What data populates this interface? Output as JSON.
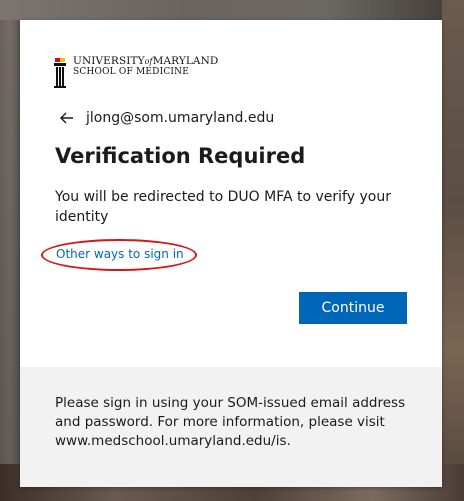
{
  "logo": {
    "line1_a": "UNIVERSITY",
    "line1_of": "of",
    "line1_b": "MARYLAND",
    "line2": "SCHOOL OF MEDICINE"
  },
  "identity": {
    "email": "jlong@som.umaryland.edu"
  },
  "heading": "Verification Required",
  "description": "You will be redirected to DUO MFA to verify your identity",
  "other_ways_link": "Other ways to sign in",
  "continue_button": "Continue",
  "footer_text": "Please sign in using your SOM-issued email address and password. For more information, please visit www.medschool.umaryland.edu/is.",
  "colors": {
    "accent": "#0067b8",
    "highlight_ellipse": "#d01a1a",
    "footer_bg": "#f2f2f2"
  },
  "icons": {
    "back": "arrow-left-icon",
    "logo": "university-mace-logo"
  }
}
